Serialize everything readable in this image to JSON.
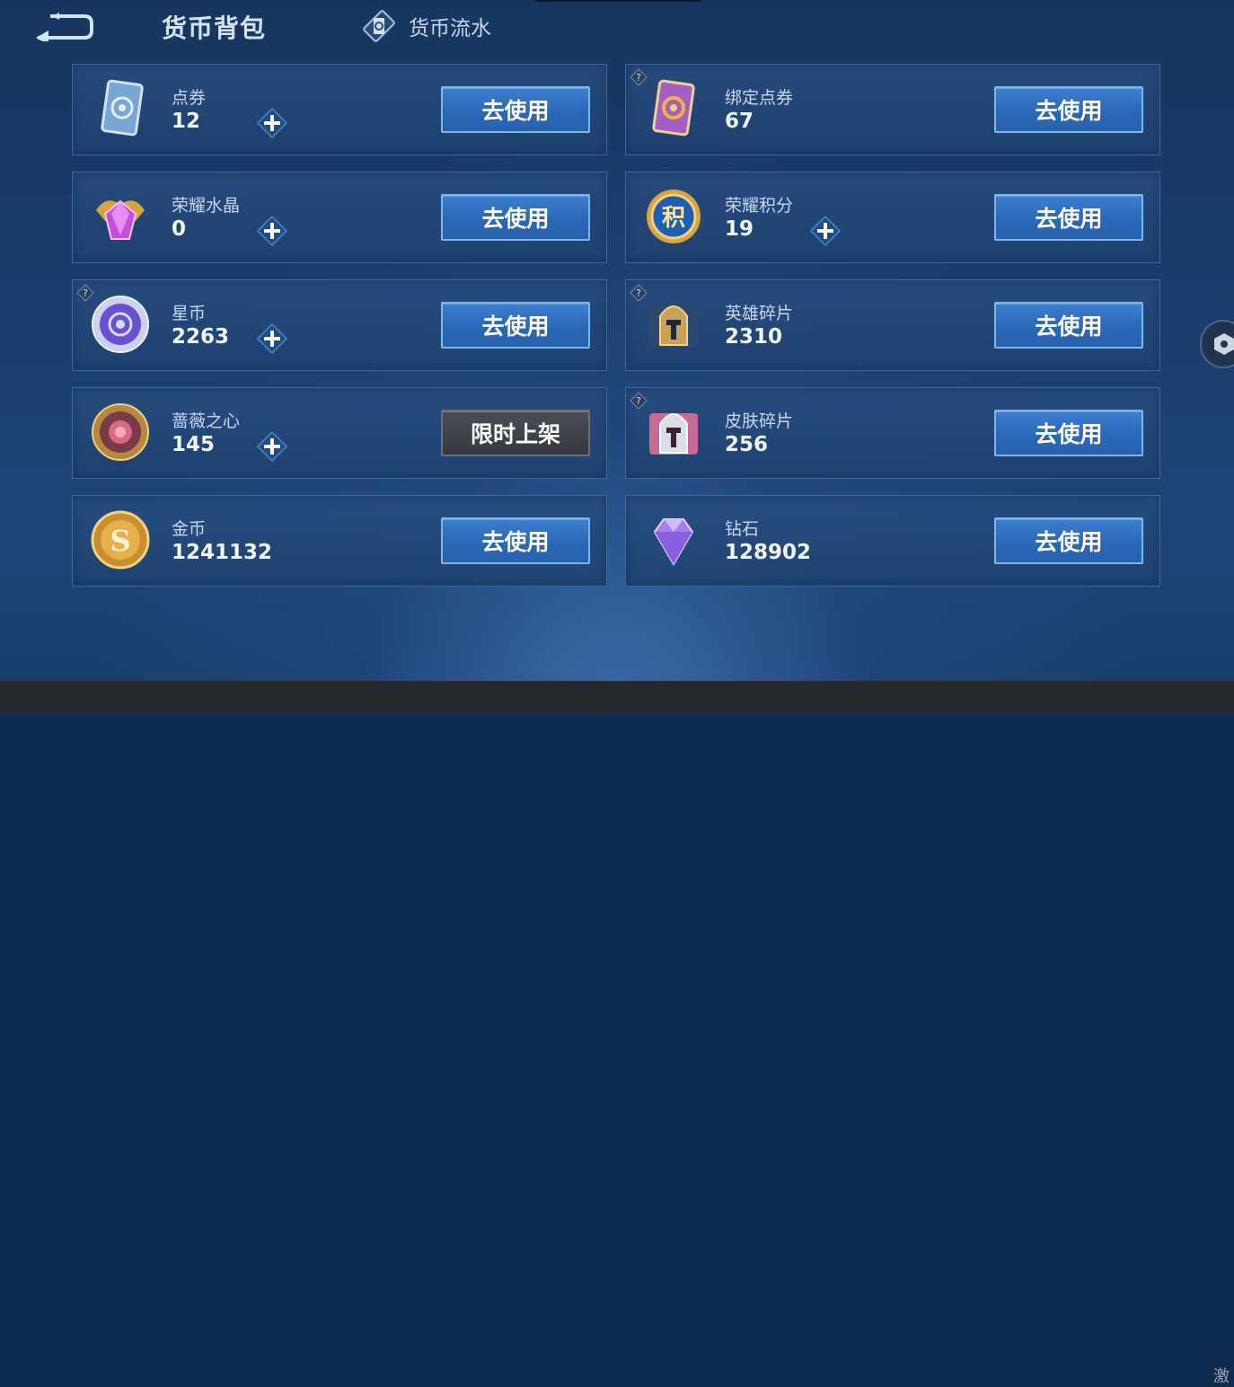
{
  "header": {
    "title": "货币背包",
    "ledger_label": "货币流水"
  },
  "corner_text": "激",
  "cards": [
    {
      "name": "点券",
      "amount": "12",
      "button": "去使用"
    },
    {
      "name": "绑定点券",
      "amount": "67",
      "button": "去使用"
    },
    {
      "name": "荣耀水晶",
      "amount": "0",
      "button": "去使用"
    },
    {
      "name": "荣耀积分",
      "amount": "19",
      "button": "去使用"
    },
    {
      "name": "星币",
      "amount": "2263",
      "button": "去使用"
    },
    {
      "name": "英雄碎片",
      "amount": "2310",
      "button": "去使用"
    },
    {
      "name": "蔷薇之心",
      "amount": "145",
      "button": "限时上架"
    },
    {
      "name": "皮肤碎片",
      "amount": "256",
      "button": "去使用"
    },
    {
      "name": "金币",
      "amount": "1241132",
      "button": "去使用"
    },
    {
      "name": "钻石",
      "amount": "128902",
      "button": "去使用"
    }
  ],
  "icons": {
    "back": "back-arrow-icon",
    "ledger": "ledger-card-icon",
    "plus": "plus-icon",
    "help": "question-mark-icon"
  },
  "colors": {
    "button": "#2a68b8",
    "button_border": "#7fb6f0",
    "disabled_button": "#3d4247",
    "card_border": "#3d6a9e"
  }
}
